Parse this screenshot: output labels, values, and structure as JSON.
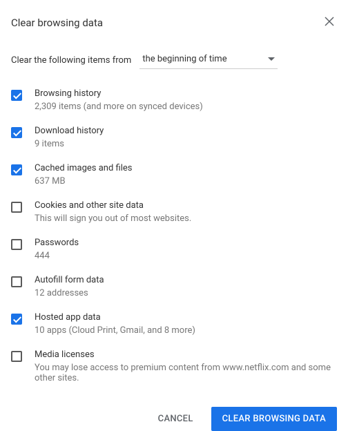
{
  "dialog": {
    "title": "Clear browsing data",
    "timeframe_label": "Clear the following items from",
    "timeframe_value": "the beginning of time",
    "items": [
      {
        "label": "Browsing history",
        "sub": "2,309 items (and more on synced devices)",
        "checked": true
      },
      {
        "label": "Download history",
        "sub": "9 items",
        "checked": true
      },
      {
        "label": "Cached images and files",
        "sub": "637 MB",
        "checked": true
      },
      {
        "label": "Cookies and other site data",
        "sub": "This will sign you out of most websites.",
        "checked": false
      },
      {
        "label": "Passwords",
        "sub": "444",
        "checked": false
      },
      {
        "label": "Autofill form data",
        "sub": "12 addresses",
        "checked": false
      },
      {
        "label": "Hosted app data",
        "sub": "10 apps (Cloud Print, Gmail, and 8 more)",
        "checked": true
      },
      {
        "label": "Media licenses",
        "sub": "You may lose access to premium content from www.netflix.com and some other sites.",
        "checked": false
      }
    ],
    "cancel_label": "CANCEL",
    "confirm_label": "CLEAR BROWSING DATA"
  }
}
